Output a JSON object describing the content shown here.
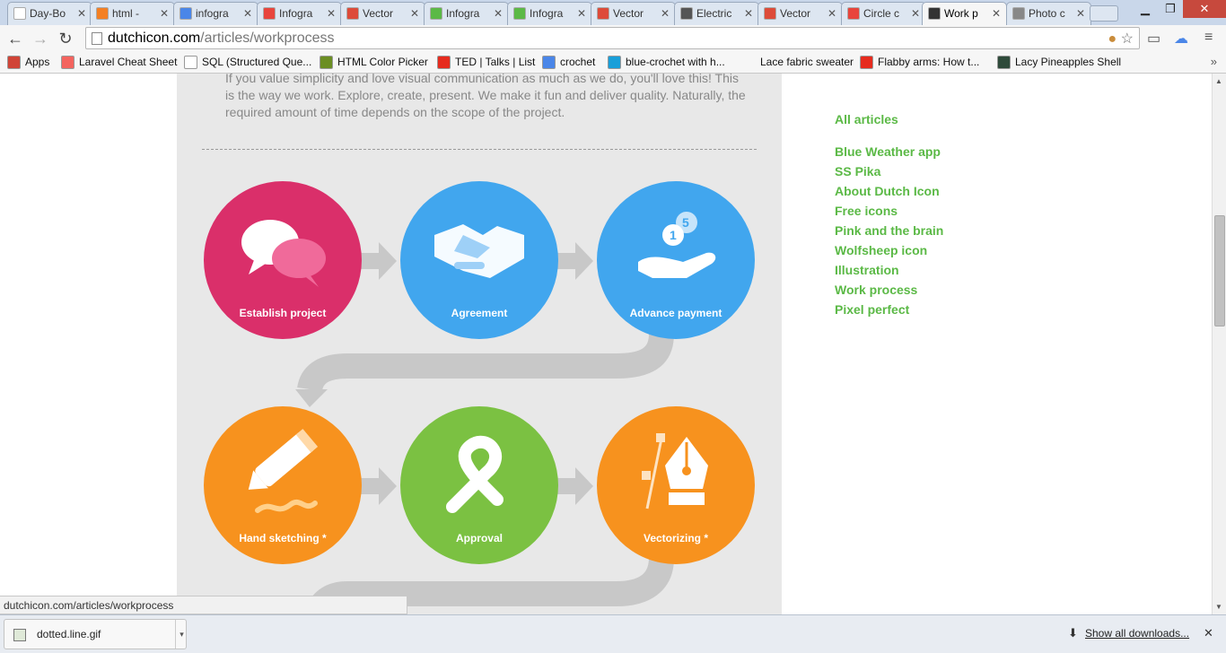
{
  "browser": {
    "tabs": [
      {
        "label": "Day-Bo",
        "favicon": "document-icon",
        "color": "#ffffff"
      },
      {
        "label": "html -",
        "favicon": "stack-icon",
        "color": "#f48024"
      },
      {
        "label": "infogra",
        "favicon": "google-icon",
        "color": "#4a86e8"
      },
      {
        "label": "Infogra",
        "favicon": "red-square-icon",
        "color": "#e8453c"
      },
      {
        "label": "Vector",
        "favicon": "chrome-icon",
        "color": "#dd4b39"
      },
      {
        "label": "Infogra",
        "favicon": "green-g-icon",
        "color": "#5bb946"
      },
      {
        "label": "Infogra",
        "favicon": "green-g-icon",
        "color": "#5bb946"
      },
      {
        "label": "Vector",
        "favicon": "chrome-icon",
        "color": "#dd4b39"
      },
      {
        "label": "Electric",
        "favicon": "circuit-icon",
        "color": "#555555"
      },
      {
        "label": "Vector",
        "favicon": "chrome-icon",
        "color": "#dd4b39"
      },
      {
        "label": "Circle c",
        "favicon": "red-square-icon",
        "color": "#e8453c"
      },
      {
        "label": "Work p",
        "favicon": "dutch-icon",
        "color": "#333333",
        "active": true
      },
      {
        "label": "Photo c",
        "favicon": "pencil-icon",
        "color": "#888888"
      }
    ],
    "url_host": "dutchicon.com",
    "url_path": "/articles/workprocess",
    "bookmarks": [
      {
        "label": "Apps",
        "icon": "apps-grid-icon",
        "color": "#d04437"
      },
      {
        "label": "Laravel Cheat Sheet",
        "icon": "laravel-icon",
        "color": "#f4645f"
      },
      {
        "label": "SQL (Structured Que...",
        "icon": "document-icon",
        "color": "#ffffff"
      },
      {
        "label": "HTML Color Picker",
        "icon": "w3-icon",
        "color": "#6b8e23"
      },
      {
        "label": "TED | Talks | List",
        "icon": "ted-icon",
        "color": "#e62b1e"
      },
      {
        "label": "crochet",
        "icon": "google-icon",
        "color": "#4a86e8"
      },
      {
        "label": "blue-crochet with h...",
        "icon": "fc-icon",
        "color": "#1a9fd9"
      },
      {
        "label": "Lace fabric sweater",
        "icon": "none",
        "color": "#ffffff"
      },
      {
        "label": "Flabby arms: How t...",
        "icon": "youtube-icon",
        "color": "#e62b1e"
      },
      {
        "label": "Lacy Pineapples Shell",
        "icon": "lacy-icon",
        "color": "#2e4a3a"
      }
    ],
    "bm_more": "»",
    "status_url": "dutchicon.com/articles/workprocess",
    "download": {
      "filename": "dotted.line.gif"
    },
    "show_all": "Show all downloads..."
  },
  "page": {
    "intro": "If you value simplicity and love visual communication as much as we do, you'll love this! This is the way we work. Explore, create, present. We make it fun and deliver quality. Naturally, the required amount of time depends on the scope of the project.",
    "steps": [
      {
        "label": "Establish project",
        "color": "#da2f6a",
        "icon": "speech-bubbles-icon"
      },
      {
        "label": "Agreement",
        "color": "#41a6ee",
        "icon": "handshake-icon"
      },
      {
        "label": "Advance payment",
        "color": "#41a6ee",
        "icon": "coins-in-hand-icon"
      },
      {
        "label": "Hand sketching *",
        "color": "#f7921e",
        "icon": "pencil-sketch-icon"
      },
      {
        "label": "Approval",
        "color": "#7bc142",
        "icon": "approval-loop-icon"
      },
      {
        "label": "Vectorizing *",
        "color": "#f7921e",
        "icon": "pen-nib-icon"
      }
    ],
    "badge_numbers": [
      "1",
      "5"
    ]
  },
  "sidebar": {
    "all_articles": "All articles",
    "links": [
      "Blue Weather app",
      "SS Pika",
      "About Dutch Icon",
      "Free icons",
      "Pink and the brain",
      "Wolfsheep icon",
      "Illustration",
      "Work process",
      "Pixel perfect"
    ]
  },
  "colors": {
    "accent_green": "#5bb946",
    "arrow_gray": "#c4c4c4"
  }
}
